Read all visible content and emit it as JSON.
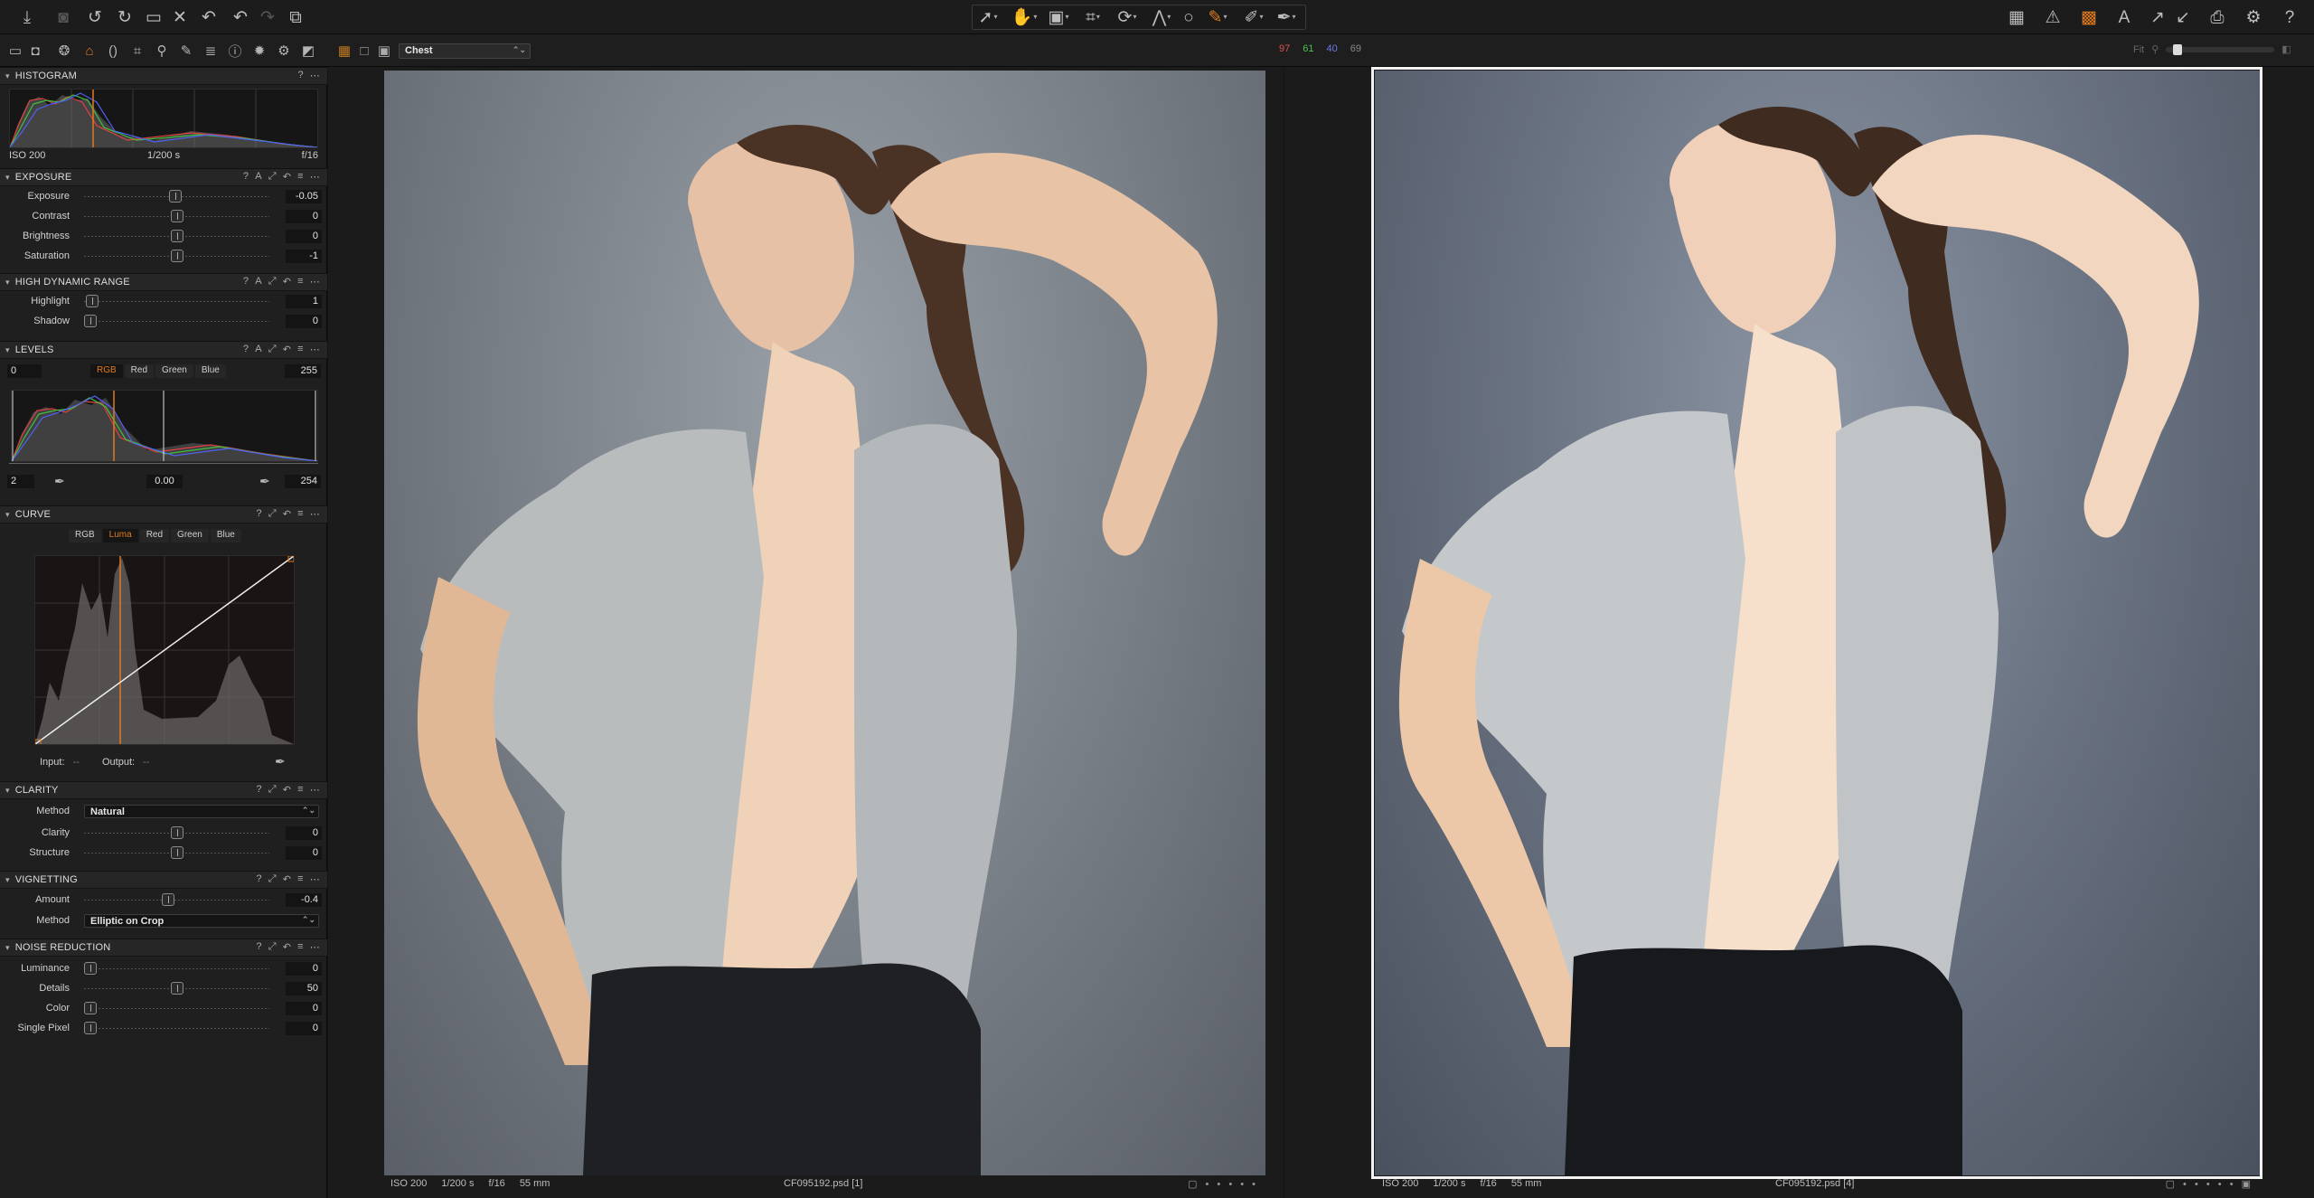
{
  "toolbar": {
    "left_icons": [
      "import-icon",
      "camera-icon",
      "rotate-left-icon",
      "rotate-right-icon",
      "export-folder-icon",
      "delete-icon",
      "undo-icon",
      "undo-alt-icon",
      "redo-icon",
      "copies-icon"
    ],
    "center_icons": [
      "select-cursor-icon",
      "pan-hand-icon",
      "loupe-icon",
      "crop-icon",
      "rotate-tool-icon",
      "keystone-icon",
      "spot-icon",
      "brush-icon",
      "erase-icon",
      "picker-icon"
    ],
    "right_icons": [
      "workspace-icon",
      "warning-icon",
      "grid-icon",
      "text-icon",
      "sync-up-icon",
      "sync-down-icon",
      "print-icon",
      "settings-icon",
      "help-icon"
    ]
  },
  "subbar": {
    "preset": "Chest",
    "rgb": {
      "r": "97",
      "g": "61",
      "b": "40",
      "l": "69"
    },
    "fit_label": "Fit"
  },
  "histogram": {
    "title": "HISTOGRAM",
    "iso": "ISO 200",
    "shutter": "1/200 s",
    "aperture": "f/16"
  },
  "exposure": {
    "title": "EXPOSURE",
    "rows": [
      {
        "label": "Exposure",
        "value": "-0.05",
        "pos": 0.49
      },
      {
        "label": "Contrast",
        "value": "0",
        "pos": 0.5
      },
      {
        "label": "Brightness",
        "value": "0",
        "pos": 0.5
      },
      {
        "label": "Saturation",
        "value": "-1",
        "pos": 0.5
      }
    ]
  },
  "hdr": {
    "title": "HIGH DYNAMIC RANGE",
    "rows": [
      {
        "label": "Highlight",
        "value": "1",
        "pos": 0.01
      },
      {
        "label": "Shadow",
        "value": "0",
        "pos": 0.0
      }
    ]
  },
  "levels": {
    "title": "LEVELS",
    "low": "0",
    "high": "255",
    "tabs": [
      "RGB",
      "Red",
      "Green",
      "Blue"
    ],
    "active_tab": "RGB",
    "out_low": "2",
    "mid": "0.00",
    "out_high": "254"
  },
  "curve": {
    "title": "CURVE",
    "tabs": [
      "RGB",
      "Luma",
      "Red",
      "Green",
      "Blue"
    ],
    "active_tab": "Luma",
    "input_label": "Input:",
    "input_value": "--",
    "output_label": "Output:",
    "output_value": "--"
  },
  "clarity": {
    "title": "CLARITY",
    "method_label": "Method",
    "method_value": "Natural",
    "rows": [
      {
        "label": "Clarity",
        "value": "0",
        "pos": 0.5
      },
      {
        "label": "Structure",
        "value": "0",
        "pos": 0.5
      }
    ]
  },
  "vignetting": {
    "title": "VIGNETTING",
    "rows": [
      {
        "label": "Amount",
        "value": "-0.4",
        "pos": 0.45
      }
    ],
    "method_label": "Method",
    "method_value": "Elliptic on Crop"
  },
  "noise": {
    "title": "NOISE REDUCTION",
    "rows": [
      {
        "label": "Luminance",
        "value": "0",
        "pos": 0.0
      },
      {
        "label": "Details",
        "value": "50",
        "pos": 0.5
      },
      {
        "label": "Color",
        "value": "0",
        "pos": 0.0
      },
      {
        "label": "Single Pixel",
        "value": "0",
        "pos": 0.0
      }
    ]
  },
  "viewer_left": {
    "iso": "ISO 200",
    "shutter": "1/200 s",
    "aperture": "f/16",
    "focal": "55 mm",
    "filename": "CF095192.psd [1]"
  },
  "viewer_right": {
    "iso": "ISO 200",
    "shutter": "1/200 s",
    "aperture": "f/16",
    "focal": "55 mm",
    "filename": "CF095192.psd [4]"
  }
}
